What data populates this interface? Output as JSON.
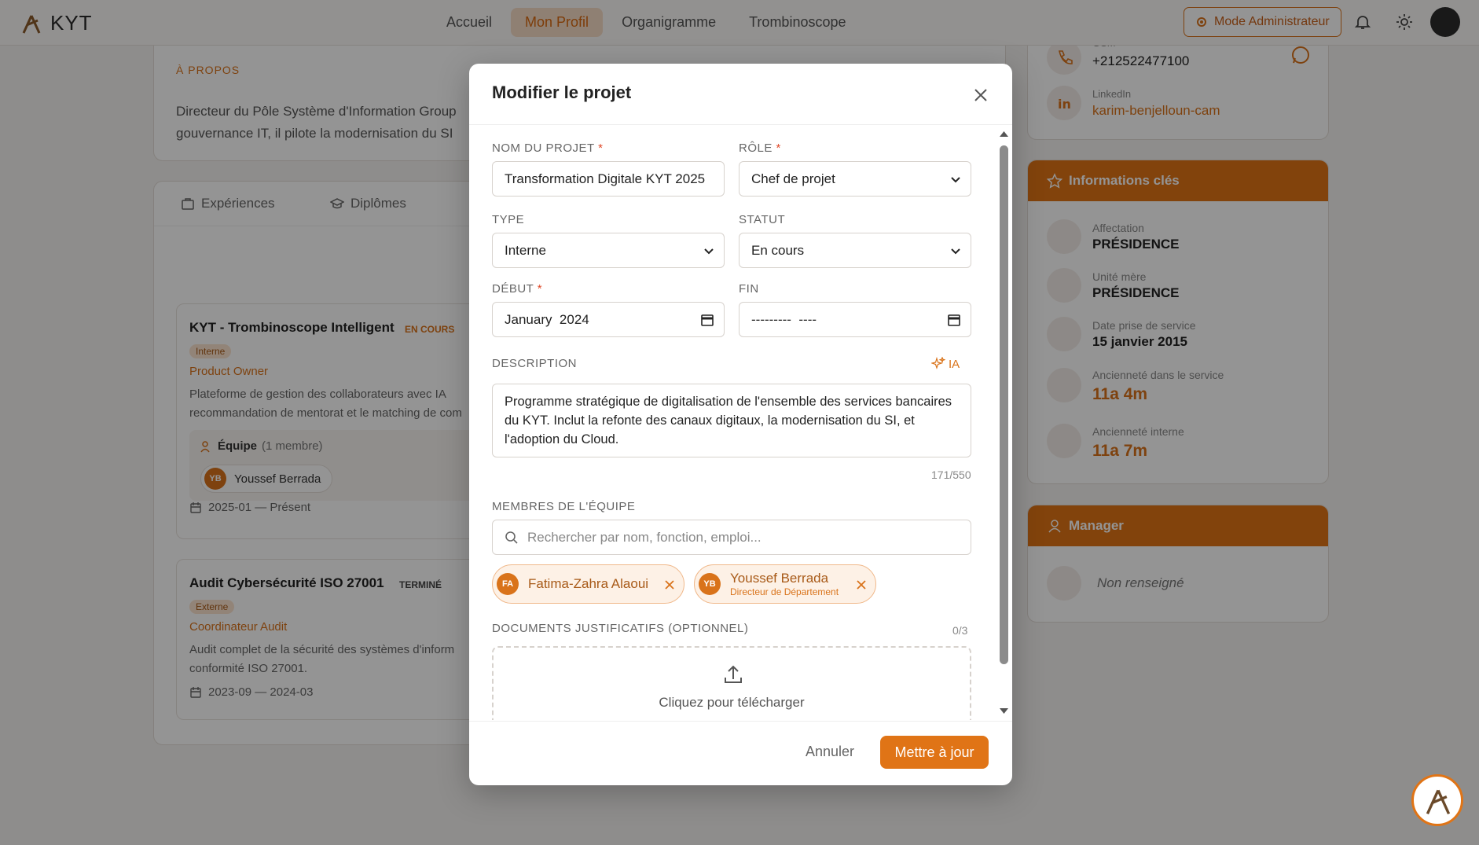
{
  "header": {
    "brand": "KYT",
    "nav": [
      "Accueil",
      "Mon Profil",
      "Organigramme",
      "Trombinoscope"
    ],
    "admin_label": "Mode Administrateur"
  },
  "about": {
    "title": "À PROPOS",
    "text_line1": "Directeur du Pôle Système d'Information Group",
    "text_line2": "gouvernance IT, il pilote la modernisation du SI"
  },
  "tabs": [
    "Expériences",
    "Diplômes"
  ],
  "projects": [
    {
      "title": "KYT - Trombinoscope Intelligent",
      "status": "EN COURS",
      "type": "Interne",
      "role": "Product Owner",
      "desc_line1": "Plateforme de gestion des collaborateurs avec IA",
      "desc_line2": "recommandation de mentorat et le matching de com",
      "team_label": "Équipe",
      "team_count": "(1 membre)",
      "member_initials": "YB",
      "member_name": "Youssef Berrada",
      "dates": "2025-01 — Présent"
    },
    {
      "title": "Audit Cybersécurité ISO 27001",
      "status": "TERMINÉ",
      "type": "Externe",
      "role": "Coordinateur Audit",
      "desc_line1": "Audit complet de la sécurité des systèmes d'inform",
      "desc_line2": "conformité ISO 27001.",
      "dates": "2023-09 — 2024-03"
    }
  ],
  "contact": {
    "phone_label": "GSM",
    "phone": "+212522477100",
    "linkedin_label": "LinkedIn",
    "linkedin": "karim-benjelloun-cam"
  },
  "key_info": {
    "title": "Informations clés",
    "items": [
      {
        "label": "Affectation",
        "value": "PRÉSIDENCE"
      },
      {
        "label": "Unité mère",
        "value": "PRÉSIDENCE"
      },
      {
        "label": "Date prise de service",
        "value": "15 janvier 2015"
      },
      {
        "label": "Ancienneté dans le service",
        "value": "11a 4m"
      },
      {
        "label": "Ancienneté interne",
        "value": "11a 7m"
      }
    ]
  },
  "manager": {
    "title": "Manager",
    "value": "Non renseigné"
  },
  "modal": {
    "title": "Modifier le projet",
    "name_label": "NOM DU PROJET",
    "name_value": "Transformation Digitale KYT 2025",
    "role_label": "RÔLE",
    "role_value": "Chef de projet",
    "type_label": "TYPE",
    "type_value": "Interne",
    "status_label": "STATUT",
    "status_value": "En cours",
    "start_label": "DÉBUT",
    "start_value": "January  2024",
    "end_label": "FIN",
    "end_value": "---------  ----",
    "desc_label": "DESCRIPTION",
    "ai_label": "IA",
    "desc_value": "Programme stratégique de digitalisation de l'ensemble des services bancaires du KYT. Inclut la refonte des canaux digitaux, la modernisation du SI, et l'adoption du Cloud.",
    "desc_count": "171/550",
    "team_label": "MEMBRES DE L'ÉQUIPE",
    "search_placeholder": "Rechercher par nom, fonction, emploi...",
    "members": [
      {
        "initials": "FA",
        "name": "Fatima-Zahra Alaoui"
      },
      {
        "initials": "YB",
        "name": "Youssef Berrada",
        "role": "Directeur de Département"
      }
    ],
    "docs_label": "DOCUMENTS JUSTIFICATIFS (OPTIONNEL)",
    "docs_count": "0/3",
    "upload_label": "Cliquez pour télécharger",
    "cancel": "Annuler",
    "submit": "Mettre à jour"
  },
  "colors": {
    "accent": "#e07416",
    "overlay": "rgba(0,0,0,0.42)"
  }
}
